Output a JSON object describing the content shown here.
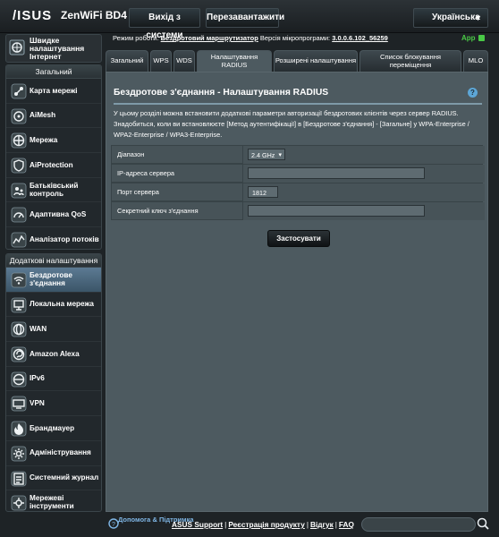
{
  "brand": {
    "logo": "/ISUS",
    "model": "ZenWiFi BD4"
  },
  "topbar": {
    "logout": "Вихід з системи",
    "reboot": "Перезавантажити",
    "language": "Українська"
  },
  "sidebar": {
    "quick": "Швидке налаштування Інтернет",
    "general_header": "Загальний",
    "general": [
      {
        "label": "Карта мережі",
        "icon": "network-map-icon"
      },
      {
        "label": "AiMesh",
        "icon": "aimesh-icon"
      },
      {
        "label": "Мережа",
        "icon": "network-icon"
      },
      {
        "label": "AiProtection",
        "icon": "shield-icon"
      },
      {
        "label": "Батьківський контроль",
        "icon": "parental-control-icon"
      },
      {
        "label": "Адаптивна QoS",
        "icon": "qos-icon"
      },
      {
        "label": "Аналізатор потоків",
        "icon": "traffic-analyzer-icon"
      }
    ],
    "advanced_header": "Додаткові налаштування",
    "advanced": [
      {
        "label": "Бездротове з'єднання",
        "icon": "wireless-icon",
        "active": true
      },
      {
        "label": "Локальна мережа",
        "icon": "lan-icon"
      },
      {
        "label": "WAN",
        "icon": "wan-icon"
      },
      {
        "label": "Amazon Alexa",
        "icon": "alexa-icon"
      },
      {
        "label": "IPv6",
        "icon": "ipv6-icon"
      },
      {
        "label": "VPN",
        "icon": "vpn-icon"
      },
      {
        "label": "Брандмауер",
        "icon": "firewall-icon"
      },
      {
        "label": "Адміністрування",
        "icon": "administration-icon"
      },
      {
        "label": "Системний журнал",
        "icon": "system-log-icon"
      },
      {
        "label": "Мережеві інструменти",
        "icon": "network-tools-icon"
      }
    ]
  },
  "status": {
    "mode_label": "Режим роботи:",
    "mode_value": "Бездротовий маршрутизатор",
    "fw_label": "Версія мікропрограми:",
    "fw_value": "3.0.0.6.102_56259",
    "app": "App"
  },
  "tabs": [
    {
      "label": "Загальний"
    },
    {
      "label": "WPS"
    },
    {
      "label": "WDS"
    },
    {
      "label": "Налаштування RADIUS",
      "active": true
    },
    {
      "label": "Розширені налаштування"
    },
    {
      "label": "Список блокування переміщення"
    },
    {
      "label": "MLO"
    }
  ],
  "main": {
    "title": "Бездротове з'єднання - Налаштування RADIUS",
    "help": "?",
    "description": "У цьому розділі можна встановити додаткові параметри авторизації бездротових клієнтів через сервер RADIUS. Знадобиться, коли ви встановлюєте [Метод аутентифікації] в [Бездротове з'єднання] - [Загальне] у WPA-Enterprise / WPA2-Enterprise / WPA3-Enterprise.",
    "fields": {
      "band_label": "Діапазон",
      "band_value": "2.4 GHz",
      "ip_label": "IP-адреса сервера",
      "ip_value": "",
      "port_label": "Порт сервера",
      "port_value": "1812",
      "secret_label": "Секретний ключ з'єднання",
      "secret_value": ""
    },
    "apply": "Застосувати"
  },
  "footer": {
    "help": "Допомога & Підтримка",
    "links": [
      "ASUS Support",
      "Реєстрація продукту",
      "Відгук",
      "FAQ"
    ],
    "search_placeholder": ""
  },
  "colors": {
    "accent_green": "#49c946",
    "panel": "#4d5a60",
    "active_nav": "#5c7a93"
  }
}
